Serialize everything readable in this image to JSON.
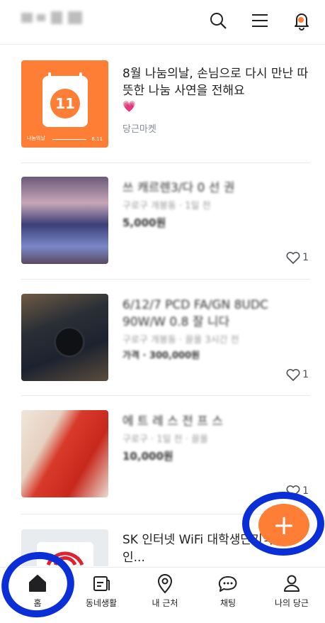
{
  "header": {
    "icons": [
      "search-icon",
      "menu-icon",
      "bell-icon"
    ],
    "accent": "#ff7e36"
  },
  "feed": {
    "promo": {
      "title": "8월 나눔의날, 손님으로 다시 만난 따뜻한 나눔 사연을 전해요",
      "emoji": "💗",
      "source": "당근마켓",
      "badge_day": "11",
      "badge_left": "나눔의날",
      "badge_right": "8.11"
    },
    "items": [
      {
        "title": "쓰 캐르렌3/다 0 선 권",
        "meta": "구로구 개봉동 · 1일 전",
        "price": "5,000원",
        "likes": "1"
      },
      {
        "title": "6/12/7 PCD FA/GN 8UDC 90W/W 0.8 잘 니다",
        "meta": "구로구 개봉동 · 끌올 3시간 전",
        "price": "가격 · 300,000원",
        "likes": "1"
      },
      {
        "title": "에 트 레 스 전 프 스",
        "meta": "구로구 · 1일 전 · 끌올",
        "price": "10,000원",
        "likes": "1"
      },
      {
        "title": "SK 인터넷 WiFi 대학생단기약정할인...",
        "meta": "",
        "price": "",
        "likes": ""
      }
    ]
  },
  "fab": {
    "label": "+"
  },
  "bottom_nav": {
    "items": [
      {
        "label": "홈",
        "icon": "home-icon"
      },
      {
        "label": "동네생활",
        "icon": "board-icon"
      },
      {
        "label": "내 근처",
        "icon": "location-pin-icon"
      },
      {
        "label": "채팅",
        "icon": "chat-icon"
      },
      {
        "label": "나의 당근",
        "icon": "profile-icon"
      }
    ]
  }
}
